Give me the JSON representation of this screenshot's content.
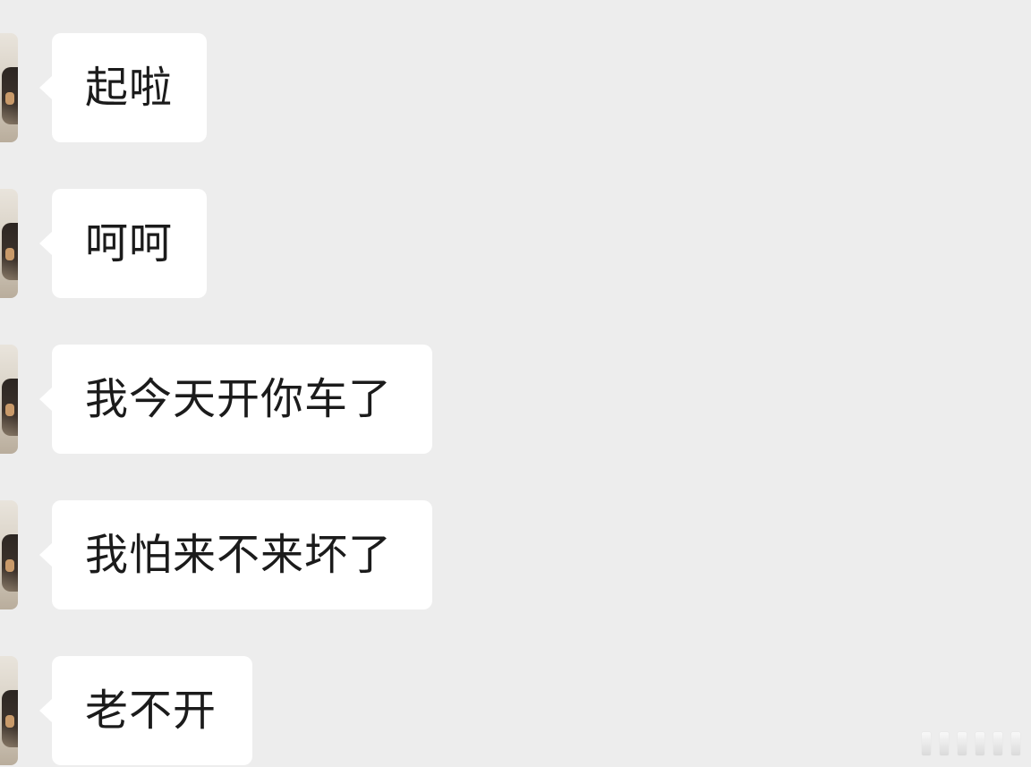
{
  "messages": [
    {
      "sender": "other",
      "text": "起啦"
    },
    {
      "sender": "other",
      "text": "呵呵"
    },
    {
      "sender": "other",
      "text": "我今天开你车了"
    },
    {
      "sender": "other",
      "text": "我怕来不来坏了"
    },
    {
      "sender": "other",
      "text": "老不开"
    }
  ],
  "colors": {
    "background": "#ededed",
    "bubble": "#ffffff",
    "text": "#1b1b1b"
  }
}
